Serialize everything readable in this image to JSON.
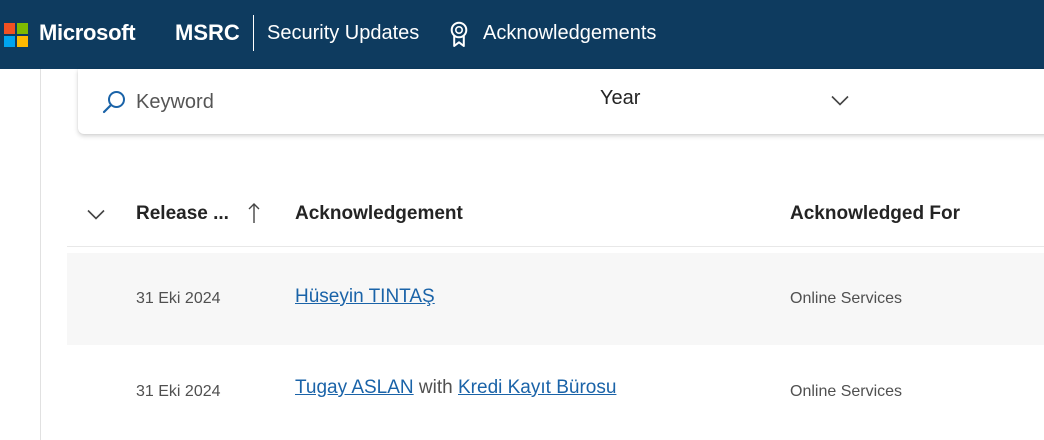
{
  "header": {
    "brand": "Microsoft",
    "site": "MSRC",
    "nav": {
      "security_updates": "Security Updates",
      "acknowledgements": "Acknowledgements"
    },
    "logo_colors": [
      "#f25022",
      "#7fba00",
      "#00a4ef",
      "#ffb900"
    ],
    "background": "#0e3b5f",
    "icons": {
      "acknowledgements": "ribbon-badge-icon"
    }
  },
  "filters": {
    "keyword_placeholder": "Keyword",
    "keyword_value": "",
    "year_label": "Year",
    "icons": {
      "search": "search-icon",
      "dropdown": "chevron-down-icon"
    }
  },
  "table": {
    "columns": {
      "release_date": "Release ...",
      "acknowledgement": "Acknowledgement",
      "acknowledged_for": "Acknowledged For"
    },
    "sort": {
      "column": "release_date",
      "direction": "ascending-arrow"
    },
    "rows": [
      {
        "date": "31 Eki 2024",
        "person": "Hüseyin TINTAŞ",
        "with_text": "",
        "org": "",
        "for": "Online Services"
      },
      {
        "date": "31 Eki 2024",
        "person": "Tugay ASLAN",
        "with_text": "with",
        "org": "Kredi Kayıt Bürosu",
        "for": "Online Services"
      }
    ]
  },
  "colors": {
    "link": "#1a63a8",
    "row_alt": "#f7f7f7"
  }
}
